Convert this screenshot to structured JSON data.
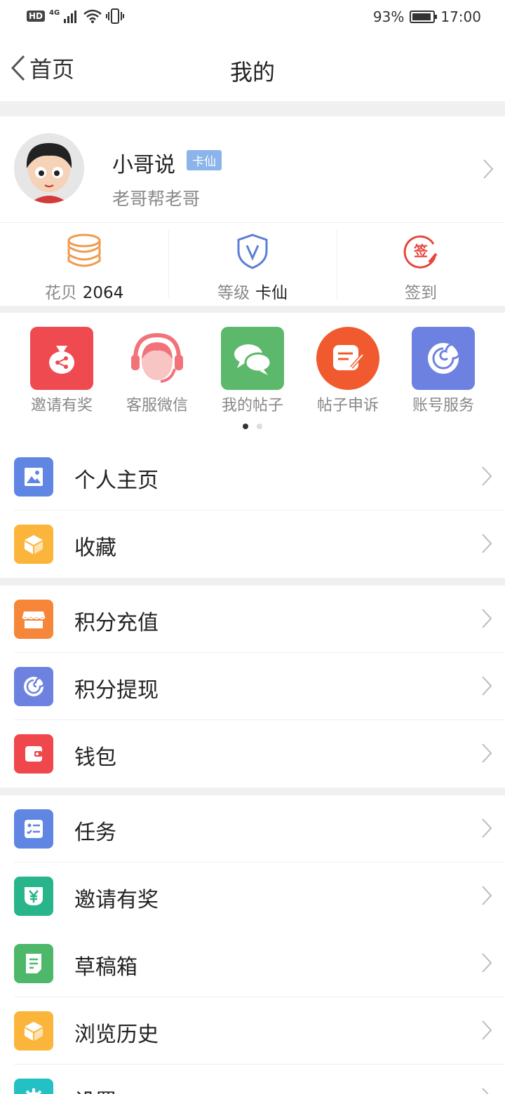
{
  "status_bar": {
    "network": "4G",
    "battery": "93%",
    "battery_level": 0.93,
    "time": "17:00"
  },
  "nav": {
    "back_label": "首页",
    "title": "我的"
  },
  "profile": {
    "username": "小哥说",
    "badge": "卡仙",
    "signature": "老哥帮老哥"
  },
  "stats": [
    {
      "icon": "coin-stack-icon",
      "label": "花贝",
      "value": "2064",
      "color": "#f09a4c"
    },
    {
      "icon": "level-shield-icon",
      "label": "等级",
      "value": "卡仙",
      "color": "#5b7fd6"
    },
    {
      "icon": "checkin-stamp-icon",
      "label": "签到",
      "value": "",
      "color": "#e8453c"
    }
  ],
  "quick_actions": [
    {
      "icon": "money-bag-icon",
      "label": "邀请有奖",
      "color": "#ef4a4f"
    },
    {
      "icon": "headset-agent-icon",
      "label": "客服微信",
      "color": "#f2727a"
    },
    {
      "icon": "chat-bubbles-icon",
      "label": "我的帖子",
      "color": "#5cb86a"
    },
    {
      "icon": "edit-note-icon",
      "label": "帖子申诉",
      "color": "#f05a2e"
    },
    {
      "icon": "spiral-icon",
      "label": "账号服务",
      "color": "#6d82e0"
    }
  ],
  "carousel": {
    "current_page": 1,
    "total_pages": 2
  },
  "menu": [
    {
      "icon": "picture-icon",
      "label": "个人主页",
      "color": "#5f86e3"
    },
    {
      "icon": "cube-icon",
      "label": "收藏",
      "color": "#fbb53b"
    },
    {
      "icon": "store-icon",
      "label": "积分充值",
      "color": "#f6873a"
    },
    {
      "icon": "spiral-icon",
      "label": "积分提现",
      "color": "#6d82e0"
    },
    {
      "icon": "wallet-icon",
      "label": "钱包",
      "color": "#f0474c"
    },
    {
      "icon": "checklist-icon",
      "label": "任务",
      "color": "#5f86e3"
    },
    {
      "icon": "yen-coupon-icon",
      "label": "邀请有奖",
      "color": "#28b58b"
    },
    {
      "icon": "draft-note-icon",
      "label": "草稿箱",
      "color": "#4db86a"
    },
    {
      "icon": "cube-icon",
      "label": "浏览历史",
      "color": "#fbb53b"
    },
    {
      "icon": "gear-icon",
      "label": "设置",
      "color": "#24c1c4"
    }
  ]
}
